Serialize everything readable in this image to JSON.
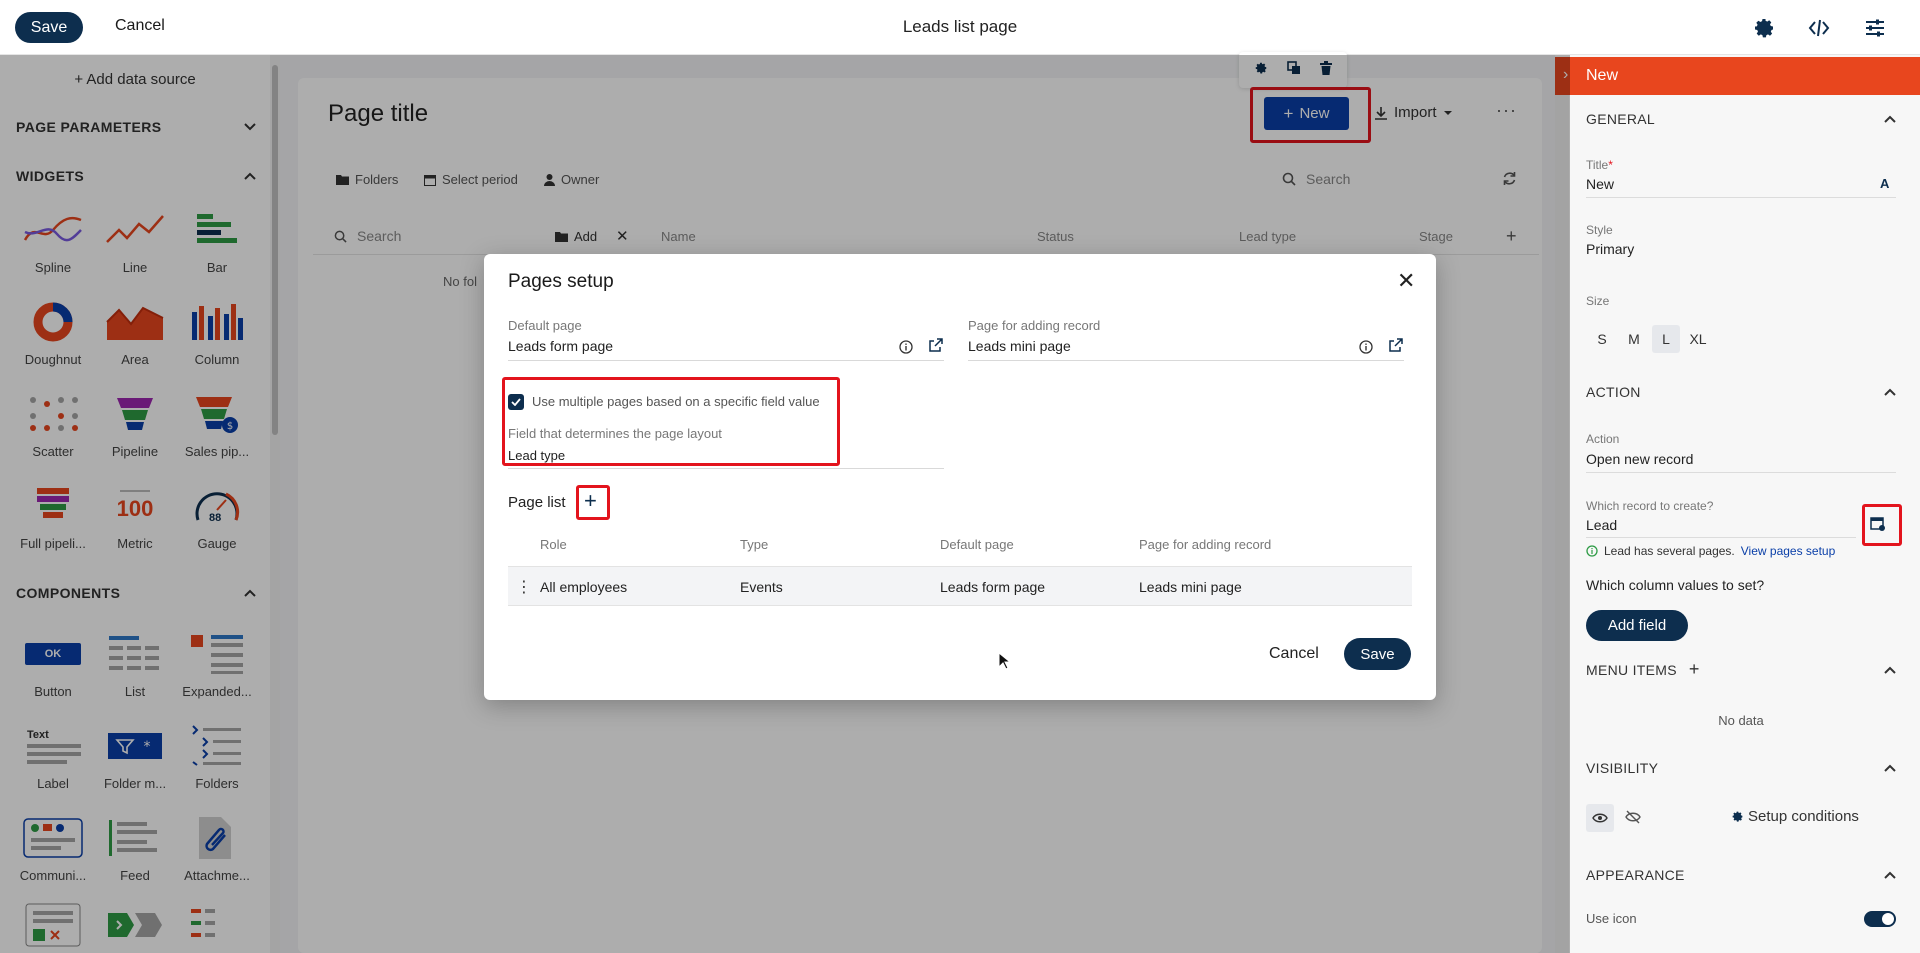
{
  "topbar": {
    "save_label": "Save",
    "cancel_label": "Cancel",
    "title": "Leads list page"
  },
  "sidebar": {
    "add_data_source": "+ Add data source",
    "sections": {
      "page_parameters": "PAGE PARAMETERS",
      "widgets": "WIDGETS",
      "components": "COMPONENTS"
    },
    "widgets": [
      "Spline",
      "Line",
      "Bar",
      "Doughnut",
      "Area",
      "Column",
      "Scatter",
      "Pipeline",
      "Sales pip...",
      "Full pipeli...",
      "Metric",
      "Gauge"
    ],
    "components": [
      "Button",
      "List",
      "Expanded...",
      "Label",
      "Folder m...",
      "Folders",
      "Communi...",
      "Feed",
      "Attachme..."
    ],
    "icon_text": {
      "metric": "100",
      "gauge": "88",
      "button_ok": "OK",
      "label_text": "Text"
    }
  },
  "canvas": {
    "page_title": "Page title",
    "new_label": "New",
    "import_label": "Import",
    "more": "···",
    "filters": {
      "folders": "Folders",
      "select_period": "Select period",
      "owner": "Owner"
    },
    "search_placeholder": "Search",
    "folder_search_placeholder": "Search",
    "add_label": "Add",
    "columns": [
      "Name",
      "Status",
      "Lead type",
      "Stage"
    ],
    "no_folders": "No fol"
  },
  "modal": {
    "title": "Pages setup",
    "default_page_label": "Default page",
    "default_page_value": "Leads form page",
    "adding_page_label": "Page for adding record",
    "adding_page_value": "Leads mini page",
    "multi_pages_label": "Use multiple pages based on a specific field value",
    "field_label": "Field that determines the page layout",
    "field_value": "Lead type",
    "page_list_label": "Page list",
    "table_headers": [
      "Role",
      "Type",
      "Default page",
      "Page for adding record"
    ],
    "rows": [
      {
        "role": "All employees",
        "type": "Events",
        "default_page": "Leads form page",
        "adding_page": "Leads mini page"
      }
    ],
    "cancel_label": "Cancel",
    "save_label": "Save"
  },
  "right_panel": {
    "title": "New",
    "general": "GENERAL",
    "title_label": "Title",
    "title_required": "*",
    "title_value": "New",
    "style_label": "Style",
    "style_value": "Primary",
    "size_label": "Size",
    "sizes": [
      "S",
      "M",
      "L",
      "XL"
    ],
    "selected_size": "L",
    "action_section": "ACTION",
    "action_label": "Action",
    "action_value": "Open new record",
    "which_record_label": "Which record to create?",
    "which_record_value": "Lead",
    "info_text": "Lead has several pages.",
    "info_link": "View pages setup",
    "column_values_label": "Which column values to set?",
    "add_field_label": "Add field",
    "menu_items": "MENU ITEMS",
    "no_data": "No data",
    "visibility": "VISIBILITY",
    "setup_conditions": "Setup conditions",
    "appearance": "APPEARANCE",
    "use_icon": "Use icon"
  },
  "colors": {
    "primary_dark": "#0d2e4e",
    "accent_orange": "#e8461e",
    "new_button_blue": "#0a3fa8",
    "highlight_red": "#e3141d"
  }
}
